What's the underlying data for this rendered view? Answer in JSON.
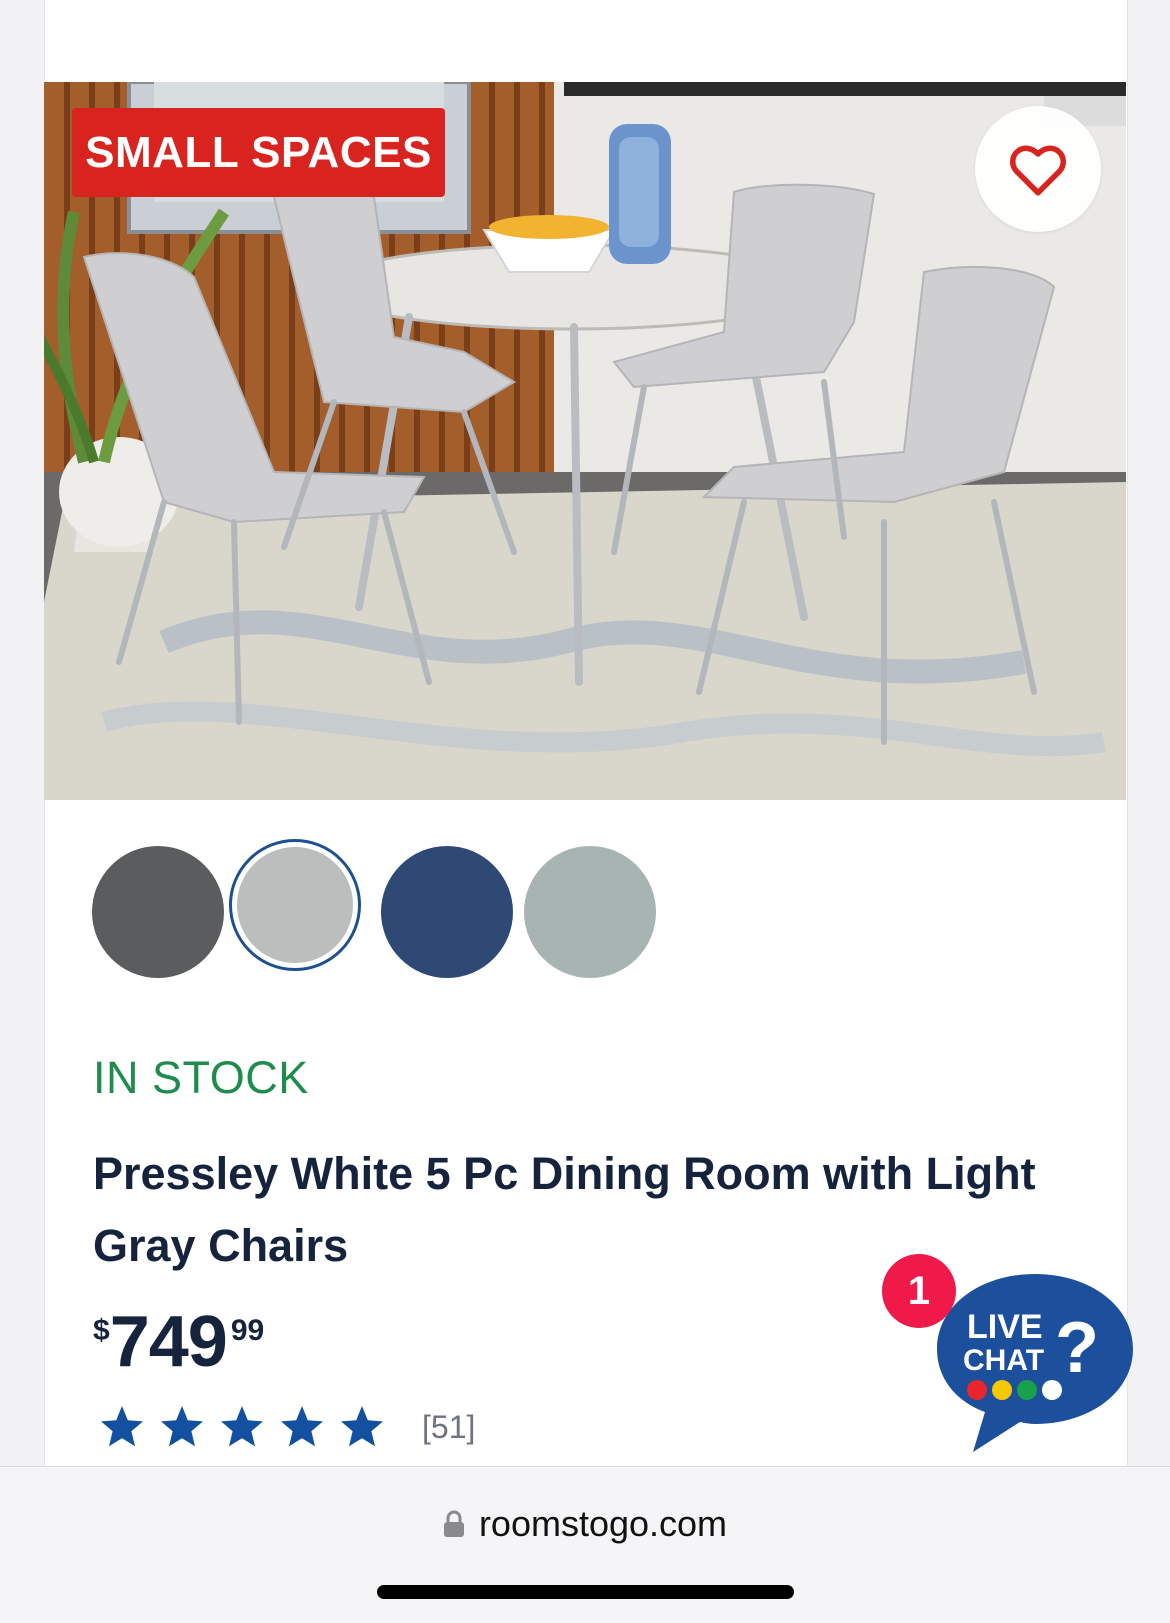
{
  "badge": {
    "text": "SMALL SPACES",
    "color": "#d8231f"
  },
  "favorite": {
    "icon": "heart-outline-icon",
    "color": "#d8231f"
  },
  "swatches": [
    {
      "name": "dark-gray",
      "color": "#5a5c5e"
    },
    {
      "name": "light-gray",
      "color": "#bcbdbd",
      "selected": true
    },
    {
      "name": "navy",
      "color": "#2e4a74"
    },
    {
      "name": "sage",
      "color": "#a8b4b2"
    }
  ],
  "product": {
    "stock_status": "IN STOCK",
    "title": "Pressley White 5 Pc Dining Room with Light Gray Chairs",
    "price_currency": "$",
    "price_dollars": "749",
    "price_cents": "99",
    "rating_stars": 5,
    "review_count": "[51]"
  },
  "live_chat": {
    "badge_count": "1",
    "line1": "LIVE",
    "line2": "CHAT"
  },
  "browser": {
    "url": "roomstogo.com"
  },
  "colors": {
    "accent_blue": "#1d4f91",
    "stock_green": "#1e8c4c",
    "text_dark": "#15243c",
    "star_blue": "#1450a0"
  }
}
